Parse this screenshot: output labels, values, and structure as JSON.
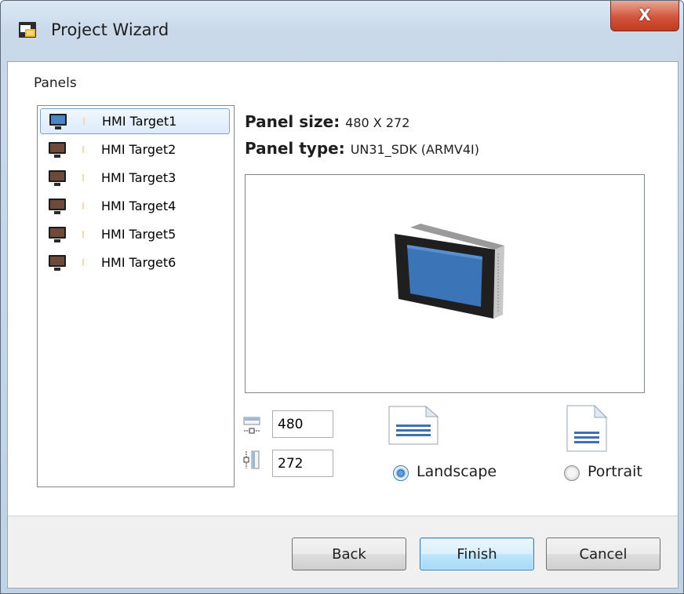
{
  "window": {
    "title": "Project Wizard",
    "close_label": "X"
  },
  "panels": {
    "label": "Panels",
    "items": [
      {
        "label": "HMI Target1",
        "selected": true
      },
      {
        "label": "HMI Target2"
      },
      {
        "label": "HMI Target3"
      },
      {
        "label": "HMI Target4"
      },
      {
        "label": "HMI Target5"
      },
      {
        "label": "HMI Target6"
      }
    ]
  },
  "details": {
    "size_label": "Panel size:",
    "size_value": "480 X 272",
    "type_label": "Panel type:",
    "type_value": "UN31_SDK (ARMV4I)"
  },
  "dimensions": {
    "width": "480",
    "height": "272"
  },
  "orientation": {
    "landscape_label": "Landscape",
    "portrait_label": "Portrait",
    "selected": "Landscape"
  },
  "buttons": {
    "back": "Back",
    "finish": "Finish",
    "cancel": "Cancel"
  },
  "colors": {
    "accent": "#3c7fb1",
    "screen": "#3b6fa8",
    "close": "#c23b22"
  }
}
